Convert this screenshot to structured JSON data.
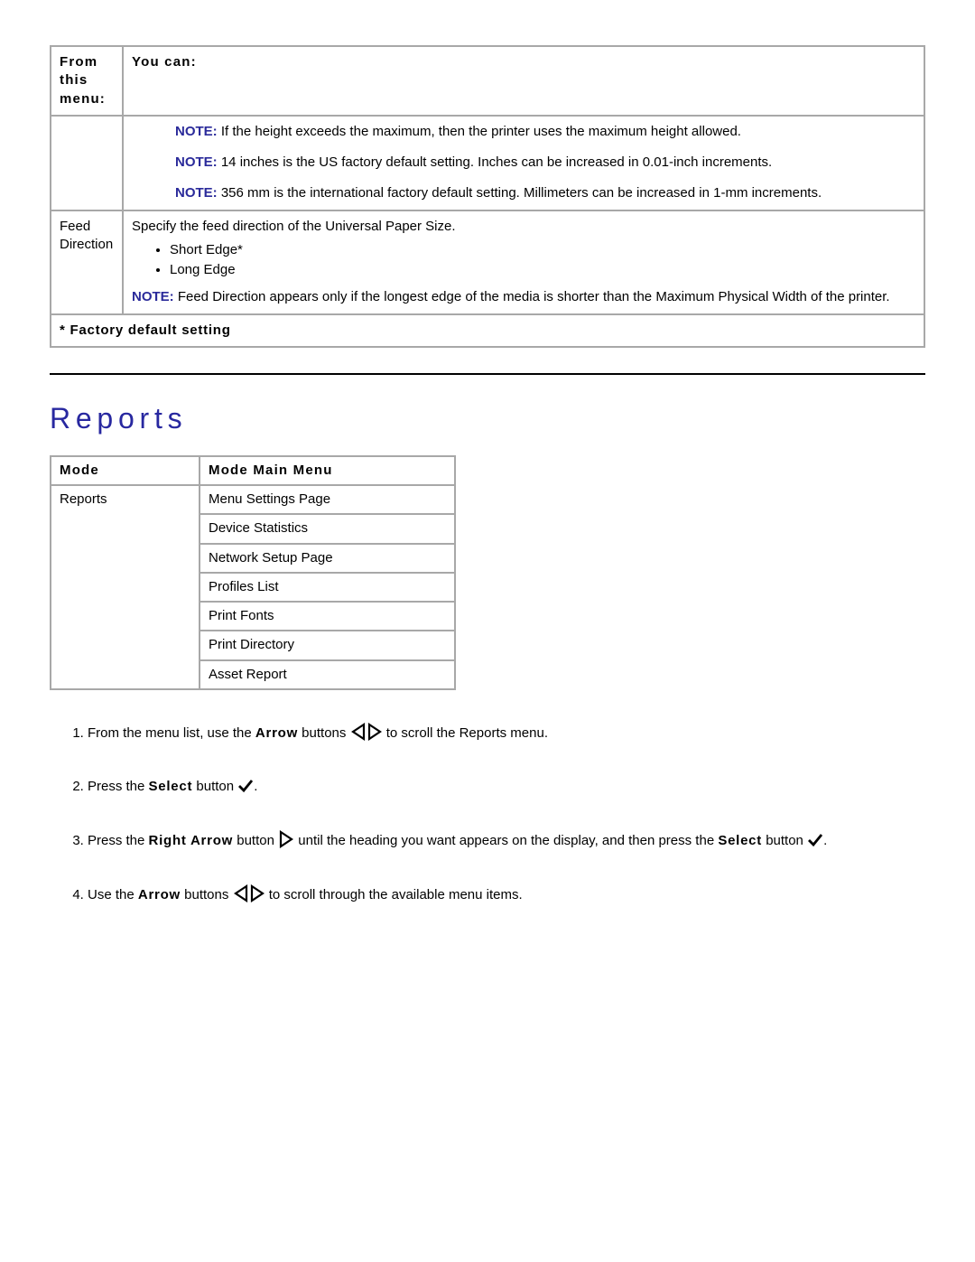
{
  "table1": {
    "header": {
      "col1": "From this menu:",
      "col2": "You can:"
    },
    "row1": {
      "note1": {
        "label": "NOTE:",
        "text": " If the height exceeds the maximum, then the printer uses the maximum height allowed."
      },
      "note2": {
        "label": "NOTE:",
        "text": " 14 inches is the US factory default setting. Inches can be increased in 0.01-inch increments."
      },
      "note3": {
        "label": "NOTE:",
        "text": " 356 mm is the international factory default setting. Millimeters can be increased in 1-mm increments."
      }
    },
    "row2": {
      "col1": "Feed Direction",
      "intro": "Specify the feed direction of the Universal Paper Size.",
      "opt1": "Short Edge*",
      "opt2": "Long Edge",
      "note": {
        "label": "NOTE:",
        "text": " Feed Direction appears only if the longest edge of the media is shorter than the Maximum Physical Width of the printer."
      }
    },
    "footer": "* Factory default setting"
  },
  "section_title": "Reports",
  "table2": {
    "header": {
      "col1": "Mode",
      "col2": "Mode Main Menu"
    },
    "col1": "Reports",
    "items": {
      "i0": "Menu Settings Page",
      "i1": "Device Statistics",
      "i2": "Network Setup Page",
      "i3": "Profiles List",
      "i4": "Print Fonts",
      "i5": "Print Directory",
      "i6": "Asset Report"
    }
  },
  "steps": {
    "s1a": "From the menu list, use the ",
    "s1b": "Arrow",
    "s1c": " buttons ",
    "s1d": " to scroll the Reports menu.",
    "s2a": "Press the ",
    "s2b": "Select",
    "s2c": " button ",
    "s2d": ".",
    "s3a": "Press the ",
    "s3b": "Right Arrow",
    "s3c": " button ",
    "s3d": " until the heading you want appears on the display, and then press the ",
    "s3e": "Select",
    "s3f": " button ",
    "s3g": ".",
    "s4a": "Use the ",
    "s4b": "Arrow",
    "s4c": " buttons ",
    "s4d": " to scroll through the available menu items."
  }
}
